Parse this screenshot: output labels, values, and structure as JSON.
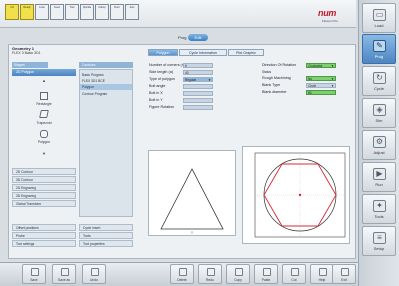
{
  "status_indicators": [
    "Init",
    "Ready",
    "Lube",
    "Feed",
    "Tool",
    "Spindle",
    "Clamp",
    "Door",
    "Axis"
  ],
  "mode": {
    "label": "Prog",
    "value": "Edit"
  },
  "brand": {
    "logo": "num",
    "sub": "Flexium Pro"
  },
  "program": {
    "name": "Geometry 1",
    "file": "FLEX 3 Basic 3D1"
  },
  "tabs": [
    "Polygon",
    "Cycle Information",
    "Plot Graphic"
  ],
  "left_column": {
    "header": "Shapes",
    "selected": "2D Polygon",
    "shapes": [
      "Rectangle",
      "Trapezoid",
      "Polygon"
    ],
    "items": [
      "2D Contour",
      "3D Contour",
      "2D Engraving",
      "3D Engraving",
      "Global Transform",
      "Offset positions",
      "Probe",
      "Tool settings"
    ]
  },
  "middle_column": {
    "header": "Contours",
    "items": [
      "Basic Program",
      "FLEX 3D1 BCE",
      "Polygon",
      "Contour Program"
    ],
    "selected_index": 2,
    "bottom_items": [
      "Cycle Insert",
      "Tools",
      "Tool properties"
    ]
  },
  "params_left": [
    {
      "label": "Number of corners (n)",
      "value": "6"
    },
    {
      "label": "Side length (a)",
      "value": "40"
    },
    {
      "label": "Type of polygon",
      "value": "Regular"
    },
    {
      "label": "Bolt angle",
      "value": ""
    },
    {
      "label": "Bolt in X",
      "value": ""
    },
    {
      "label": "Bolt in Y",
      "value": ""
    },
    {
      "label": "Figure Rotation",
      "value": ""
    }
  ],
  "params_right": [
    {
      "label": "Direction Of Rotation",
      "value": "Clockwise"
    },
    {
      "label": "Status",
      "value": ""
    },
    {
      "label": "Rough Machining",
      "value": "No"
    },
    {
      "label": "Blank Type",
      "value": "Circle"
    },
    {
      "label": "Blank diameter",
      "value": "80"
    }
  ],
  "right_sidebar": [
    "Load",
    "Prog",
    "Cycle",
    "Sim",
    "Adjust",
    "Run",
    "Tools",
    "Setup"
  ],
  "bottom_bar": [
    "Save",
    "Save as",
    "Undo",
    "Delete",
    "Redo",
    "Copy",
    "Paste",
    "Cut",
    "Help",
    "Exit"
  ],
  "colors": {
    "accent": "#4a84c0",
    "polygon": "#d82a3a",
    "green": "#7bd26e"
  }
}
